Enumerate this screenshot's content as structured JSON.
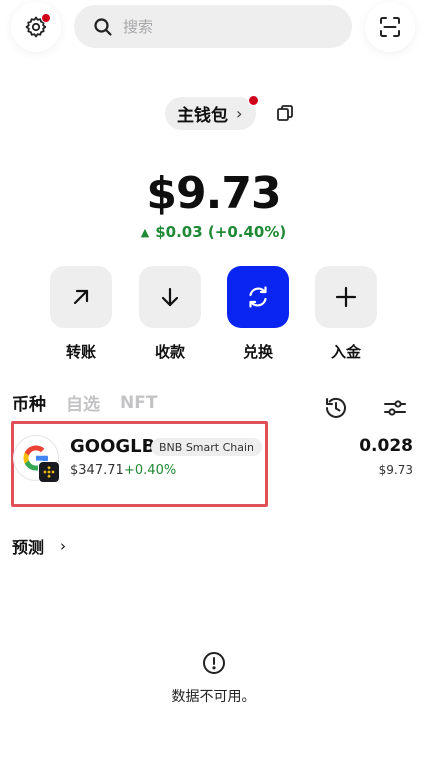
{
  "search": {
    "placeholder": "搜索"
  },
  "wallet": {
    "name": "主钱包",
    "chevron": "›"
  },
  "balance": {
    "total": "$9.73",
    "change": "$0.03 (+0.40%)",
    "change_arrow": "▲"
  },
  "actions": [
    {
      "label": "转账",
      "icon": "arrow-up-right-icon"
    },
    {
      "label": "收款",
      "icon": "arrow-down-icon"
    },
    {
      "label": "兑换",
      "icon": "swap-icon"
    },
    {
      "label": "入金",
      "icon": "plus-icon"
    }
  ],
  "tabs": [
    {
      "label": "币种",
      "active": true
    },
    {
      "label": "自选",
      "active": false
    },
    {
      "label": "NFT",
      "active": false
    }
  ],
  "assets": [
    {
      "symbol": "GOOGLB",
      "chain": "BNB Smart Chain",
      "price": "$347.71",
      "change": "+0.40%",
      "amount": "0.028",
      "value": "$9.73"
    }
  ],
  "predict": {
    "label": "预测",
    "chevron": "›"
  },
  "empty": {
    "message": "数据不可用。"
  },
  "colors": {
    "accent": "#0a24f2",
    "positive": "#1f8a35",
    "notification": "#d0021b",
    "highlight": "#e0505a"
  }
}
